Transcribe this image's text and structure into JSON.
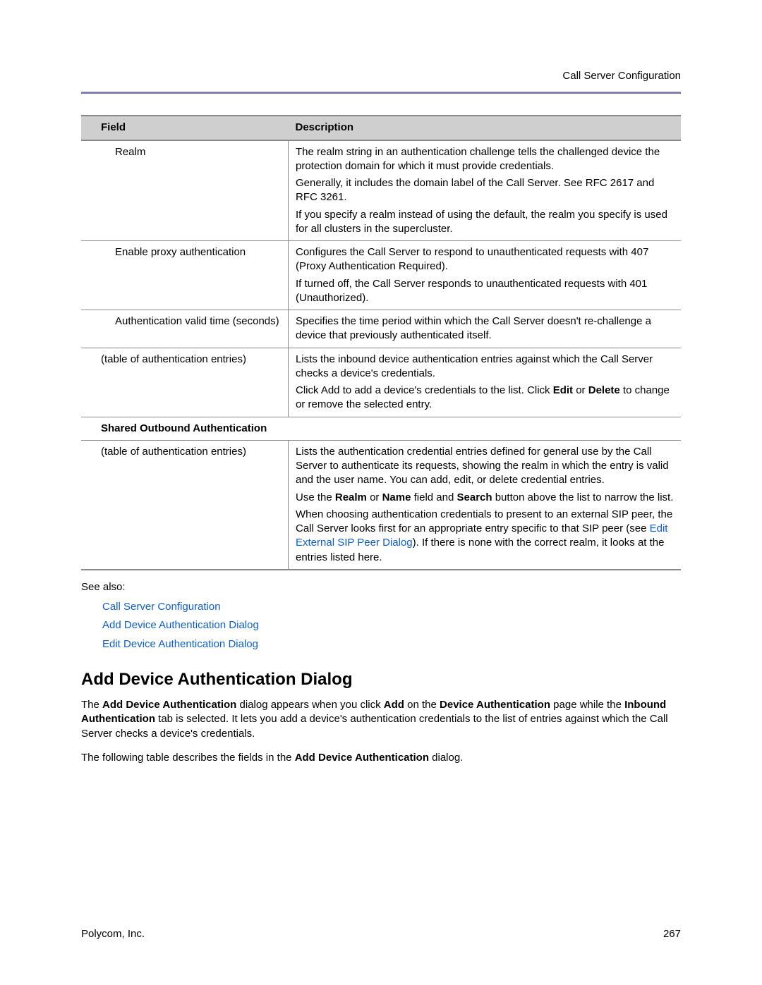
{
  "header": {
    "title": "Call Server Configuration"
  },
  "table": {
    "headers": {
      "field": "Field",
      "description": "Description"
    },
    "rows": {
      "realm": {
        "field": "Realm",
        "p1": "The realm string in an authentication challenge tells the challenged device the protection domain for which it must provide credentials.",
        "p2": "Generally, it includes the domain label of the Call Server. See RFC 2617 and RFC 3261.",
        "p3": "If you specify a realm instead of using the default, the realm you specify is used for all clusters in the supercluster."
      },
      "enableProxy": {
        "field": "Enable proxy authentication",
        "p1": "Configures the Call Server to respond to unauthenticated requests with 407 (Proxy Authentication Required).",
        "p2": "If turned off, the Call Server responds to unauthenticated requests with 401 (Unauthorized)."
      },
      "authValid": {
        "field": "Authentication valid time (seconds)",
        "p1": "Specifies the time period within which the Call Server doesn't re-challenge a device that previously authenticated itself."
      },
      "inboundEntries": {
        "field": "(table of authentication entries)",
        "p1": "Lists the inbound device authentication entries against which the Call Server checks a device's credentials.",
        "p2a": "Click Add to add a device's credentials to the list. Click ",
        "p2b": "Edit",
        "p2c": " or ",
        "p2d": "Delete",
        "p2e": " to change or remove the selected entry."
      },
      "sectionOutbound": {
        "label": "Shared Outbound Authentication"
      },
      "outboundEntries": {
        "field": "(table of authentication entries)",
        "p1": "Lists the authentication credential entries defined for general use by the Call Server to authenticate its requests, showing the realm in which the entry is valid and the user name. You can add, edit, or delete credential entries.",
        "p2a": "Use the ",
        "p2b": "Realm",
        "p2c": " or ",
        "p2d": "Name",
        "p2e": " field and ",
        "p2f": "Search",
        "p2g": " button above the list to narrow the list.",
        "p3a": "When choosing authentication credentials to present to an external SIP peer, the Call Server looks first for an appropriate entry specific to that SIP peer (see ",
        "p3link": "Edit External SIP Peer Dialog",
        "p3b": "). If there is none with the correct realm, it looks at the entries listed here."
      }
    }
  },
  "seeAlso": {
    "label": "See also:",
    "links": [
      "Call Server Configuration",
      "Add Device Authentication Dialog",
      "Edit Device Authentication Dialog"
    ]
  },
  "section": {
    "heading": "Add Device Authentication Dialog",
    "para1": {
      "a": "The ",
      "b": "Add Device Authentication",
      "c": " dialog appears when you click ",
      "d": "Add",
      "e": " on the ",
      "f": "Device Authentication",
      "g": " page while the ",
      "h": "Inbound Authentication",
      "i": " tab is selected. It lets you add a device's authentication credentials to the list of entries against which the Call Server checks a device's credentials."
    },
    "para2": {
      "a": "The following table describes the fields in the ",
      "b": "Add Device Authentication",
      "c": " dialog."
    }
  },
  "footer": {
    "company": "Polycom, Inc.",
    "page": "267"
  }
}
